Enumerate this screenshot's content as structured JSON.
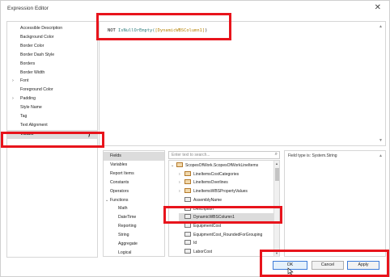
{
  "window": {
    "title": "Expression Editor",
    "close_icon": "close-icon"
  },
  "properties": [
    {
      "label": "Accessible Description",
      "expandable": false
    },
    {
      "label": "Background Color",
      "expandable": false
    },
    {
      "label": "Border Color",
      "expandable": false
    },
    {
      "label": "Border Dash Style",
      "expandable": false
    },
    {
      "label": "Borders",
      "expandable": false
    },
    {
      "label": "Border Width",
      "expandable": false
    },
    {
      "label": "Font",
      "expandable": true
    },
    {
      "label": "Foreground Color",
      "expandable": false
    },
    {
      "label": "Padding",
      "expandable": true
    },
    {
      "label": "Style Name",
      "expandable": false
    },
    {
      "label": "Tag",
      "expandable": false
    },
    {
      "label": "Text Alignment",
      "expandable": false
    },
    {
      "label": "Visible",
      "expandable": false,
      "selected": true,
      "badge": "f"
    }
  ],
  "expression": {
    "keyword": "NOT",
    "function": "IsNullOrEmpty(",
    "field": "[DynamicWBSColumn1]",
    "close": ")"
  },
  "categories": [
    {
      "label": "Fields",
      "selected": true
    },
    {
      "label": "Variables"
    },
    {
      "label": "Report Items"
    },
    {
      "label": "Constants"
    },
    {
      "label": "Operators"
    },
    {
      "label": "Functions",
      "expanded": true
    },
    {
      "label": "Math",
      "sub": true
    },
    {
      "label": "DateTime",
      "sub": true
    },
    {
      "label": "Reporting",
      "sub": true
    },
    {
      "label": "String",
      "sub": true
    },
    {
      "label": "Aggregate",
      "sub": true
    },
    {
      "label": "Logical",
      "sub": true
    }
  ],
  "search": {
    "placeholder": "Enter text to search..."
  },
  "tree": [
    {
      "label": "ScopesOfWork.ScopesOfWorkLineItems",
      "twisty": "v",
      "indent": 0,
      "type": "table"
    },
    {
      "label": "LineItemsCostCategories",
      "twisty": ">",
      "indent": 1,
      "type": "table"
    },
    {
      "label": "LineItemsOverlines",
      "twisty": ">",
      "indent": 1,
      "type": "table"
    },
    {
      "label": "LineItemsWBSPropertyValues",
      "twisty": ">",
      "indent": 1,
      "type": "table"
    },
    {
      "label": "AssemblyName",
      "twisty": "",
      "indent": 1,
      "type": "field"
    },
    {
      "label": "Description",
      "twisty": "",
      "indent": 1,
      "type": "field"
    },
    {
      "label": "DynamicWBSColumn1",
      "twisty": "",
      "indent": 1,
      "type": "field",
      "selected": true
    },
    {
      "label": "EquipmentCost",
      "twisty": "",
      "indent": 1,
      "type": "field"
    },
    {
      "label": "EquipmentCost_RoundedForGrouping",
      "twisty": "",
      "indent": 1,
      "type": "field"
    },
    {
      "label": "Id",
      "twisty": "",
      "indent": 1,
      "type": "field"
    },
    {
      "label": "LaborCost",
      "twisty": "",
      "indent": 1,
      "type": "field"
    }
  ],
  "description": {
    "text": "Field type is: System.String"
  },
  "buttons": {
    "ok": "OK",
    "cancel": "Cancel",
    "apply": "Apply"
  },
  "colors": {
    "highlight": "#e8141c",
    "selection": "#dcdcdc",
    "accent": "#3d7bd9"
  }
}
